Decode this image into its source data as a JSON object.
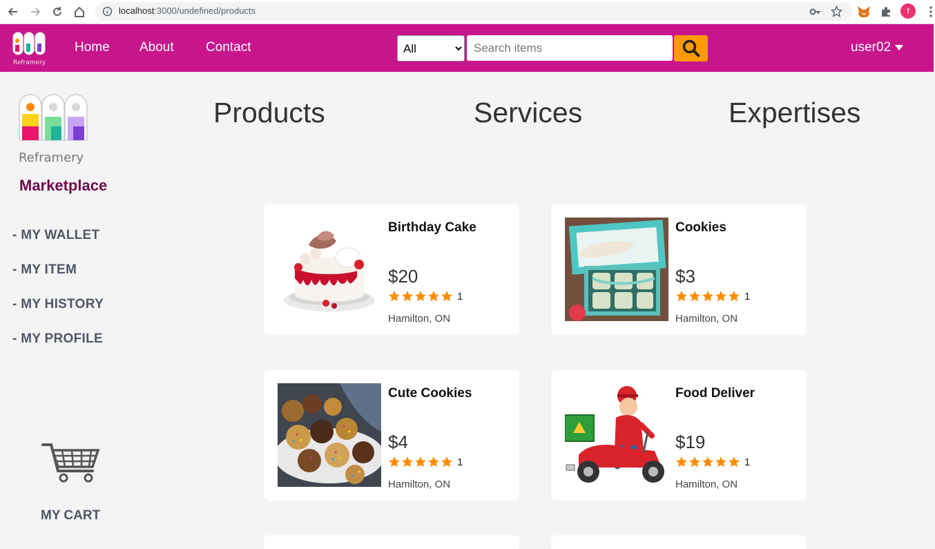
{
  "browser": {
    "url_host": "localhost",
    "url_rest": ":3000/undefined/products",
    "profile_initial": "f"
  },
  "navbar": {
    "brand_color": "#c8158c",
    "links": [
      "Home",
      "About",
      "Contact"
    ],
    "category_select": {
      "selected": "All"
    },
    "search": {
      "placeholder": "Search items",
      "button_color": "#ff9a00"
    },
    "user": "user02"
  },
  "sidebar": {
    "logo_text": "Reframery",
    "title": "Marketplace",
    "items": [
      "- MY WALLET",
      "- MY ITEM",
      "- MY HISTORY",
      "- MY PROFILE"
    ],
    "cart_label": "MY CART"
  },
  "sections": [
    "Products",
    "Services",
    "Expertises"
  ],
  "products": [
    {
      "name": "Birthday Cake",
      "price": "$20",
      "rating": 5,
      "rating_count": "1",
      "location": "Hamilton, ON",
      "image": "cake-image"
    },
    {
      "name": "Cookies",
      "price": "$3",
      "rating": 5,
      "rating_count": "1",
      "location": "Hamilton, ON",
      "image": "cookie-box-image"
    },
    {
      "name": "Cute Cookies",
      "price": "$4",
      "rating": 5,
      "rating_count": "1",
      "location": "Hamilton, ON",
      "image": "sprinkle-cookies-image"
    },
    {
      "name": "Food Deliver",
      "price": "$19",
      "rating": 5,
      "rating_count": "1",
      "location": "Hamilton, ON",
      "image": "delivery-scooter-image"
    }
  ],
  "colors": {
    "star": "#ff8c00",
    "accent": "#6d0a4c"
  }
}
